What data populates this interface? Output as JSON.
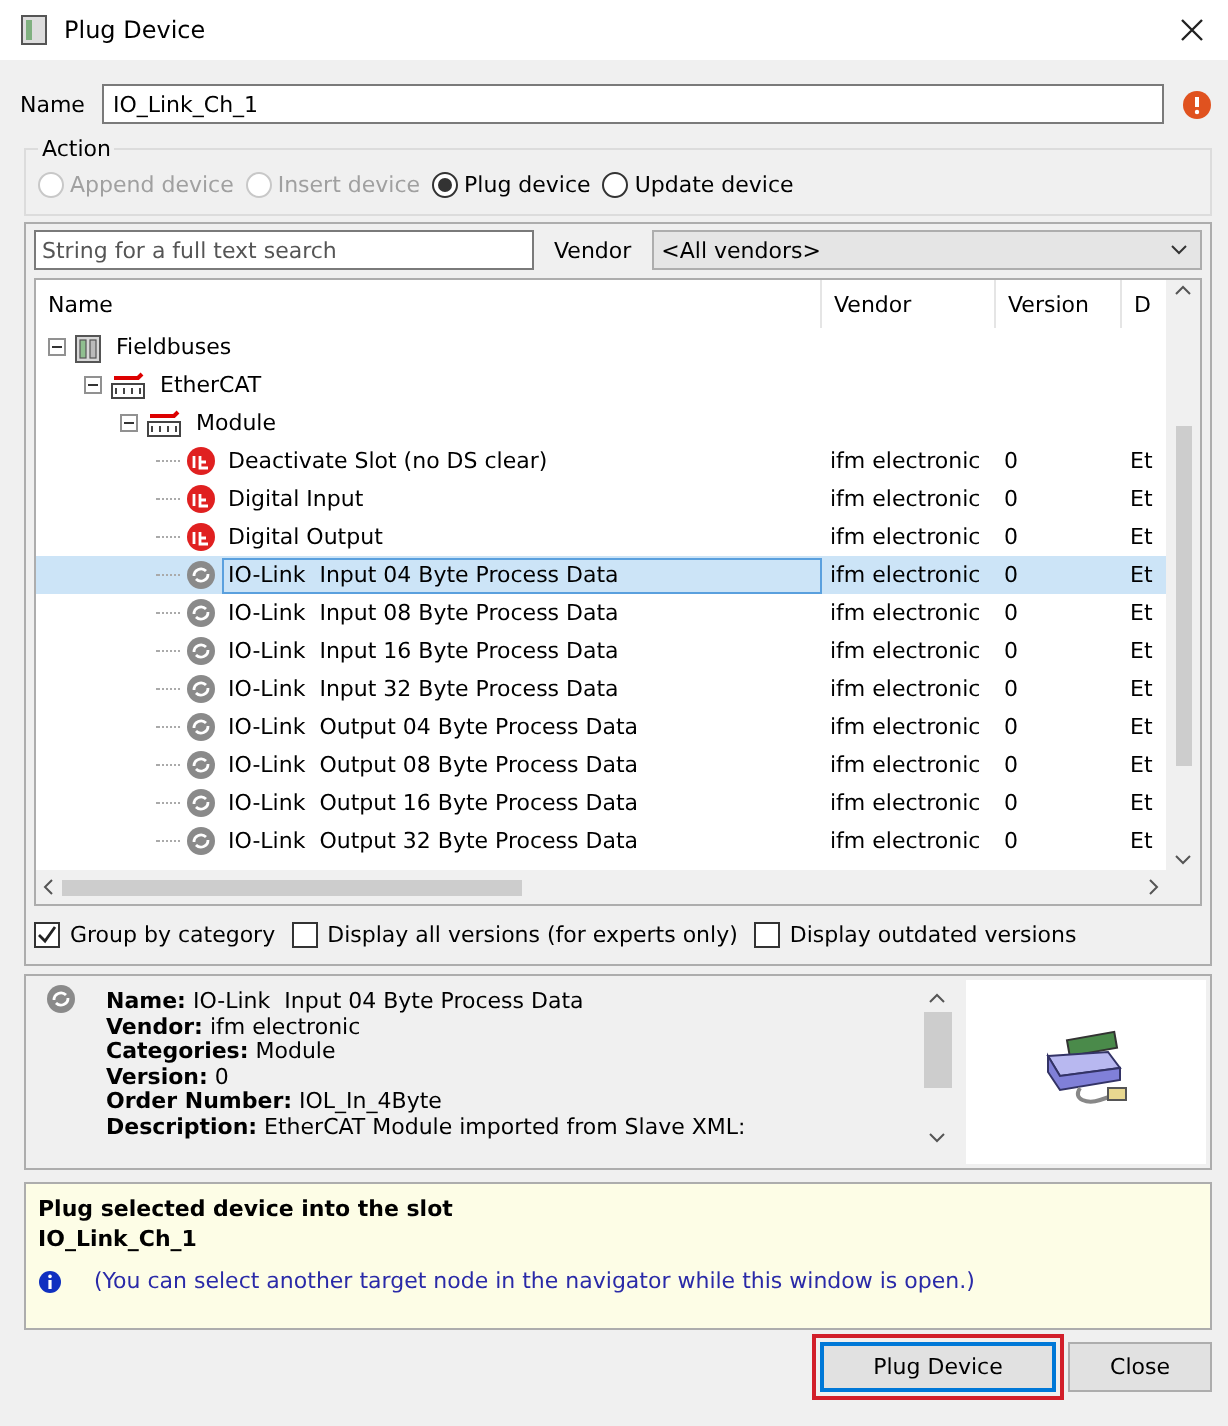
{
  "window": {
    "title": "Plug Device"
  },
  "name_field": {
    "label": "Name",
    "value": "IO_Link_Ch_1",
    "error": true
  },
  "action": {
    "title": "Action",
    "options": [
      {
        "label": "Append device",
        "selected": false,
        "disabled": true
      },
      {
        "label": "Insert device",
        "selected": false,
        "disabled": true
      },
      {
        "label": "Plug device",
        "selected": true,
        "disabled": false
      },
      {
        "label": "Update device",
        "selected": false,
        "disabled": false
      }
    ]
  },
  "search": {
    "placeholder": "String for a full text search"
  },
  "vendor": {
    "label": "Vendor",
    "value": "<All vendors>"
  },
  "table": {
    "columns": [
      "Name",
      "Vendor",
      "Version",
      "D"
    ],
    "tree": [
      {
        "label": "Fieldbuses",
        "kind": "rack",
        "expanded": true,
        "children": [
          {
            "label": "EtherCAT",
            "kind": "bus",
            "expanded": true,
            "children": [
              {
                "label": "Module",
                "kind": "bus",
                "expanded": true,
                "children": [
                  {
                    "label": "Deactivate Slot (no DS clear)",
                    "kind": "ifm",
                    "vendor": "ifm electronic",
                    "version": "0",
                    "column_4": "Et",
                    "selected": false
                  },
                  {
                    "label": "Digital Input",
                    "kind": "ifm",
                    "vendor": "ifm electronic",
                    "version": "0",
                    "column_4": "Et",
                    "selected": false
                  },
                  {
                    "label": "Digital Output",
                    "kind": "ifm",
                    "vendor": "ifm electronic",
                    "version": "0",
                    "column_4": "Et",
                    "selected": false
                  },
                  {
                    "label": "IO-Link  Input 04 Byte Process Data",
                    "kind": "iolink",
                    "vendor": "ifm electronic",
                    "version": "0",
                    "column_4": "Et",
                    "selected": true
                  },
                  {
                    "label": "IO-Link  Input 08 Byte Process Data",
                    "kind": "iolink",
                    "vendor": "ifm electronic",
                    "version": "0",
                    "column_4": "Et",
                    "selected": false
                  },
                  {
                    "label": "IO-Link  Input 16 Byte Process Data",
                    "kind": "iolink",
                    "vendor": "ifm electronic",
                    "version": "0",
                    "column_4": "Et",
                    "selected": false
                  },
                  {
                    "label": "IO-Link  Input 32 Byte Process Data",
                    "kind": "iolink",
                    "vendor": "ifm electronic",
                    "version": "0",
                    "column_4": "Et",
                    "selected": false
                  },
                  {
                    "label": "IO-Link  Output 04 Byte Process Data",
                    "kind": "iolink",
                    "vendor": "ifm electronic",
                    "version": "0",
                    "column_4": "Et",
                    "selected": false
                  },
                  {
                    "label": "IO-Link  Output 08 Byte Process Data",
                    "kind": "iolink",
                    "vendor": "ifm electronic",
                    "version": "0",
                    "column_4": "Et",
                    "selected": false
                  },
                  {
                    "label": "IO-Link  Output 16 Byte Process Data",
                    "kind": "iolink",
                    "vendor": "ifm electronic",
                    "version": "0",
                    "column_4": "Et",
                    "selected": false
                  },
                  {
                    "label": "IO-Link  Output 32 Byte Process Data",
                    "kind": "iolink",
                    "vendor": "ifm electronic",
                    "version": "0",
                    "column_4": "Et",
                    "selected": false
                  }
                ]
              }
            ]
          }
        ]
      }
    ]
  },
  "options": [
    {
      "label": "Group by category",
      "checked": true
    },
    {
      "label": "Display all versions (for experts only)",
      "checked": false
    },
    {
      "label": "Display outdated versions",
      "checked": false
    }
  ],
  "details": {
    "lines": [
      "**Name:** IO-Link  Input 04 Byte Process Data",
      "**Vendor:** ifm electronic",
      "**Categories:** Module",
      "**Version:** 0",
      "**Order Number:** IOL_In_4Byte",
      "**Description:** EtherCAT Module imported from Slave XML:"
    ]
  },
  "info": {
    "title": "Plug selected device into the slot",
    "target": "IO_Link_Ch_1",
    "note": "(You can select another target node in the navigator while this window is open.)"
  },
  "buttons": [
    {
      "label": "Plug Device",
      "default": true
    },
    {
      "label": "Close",
      "default": false
    }
  ]
}
